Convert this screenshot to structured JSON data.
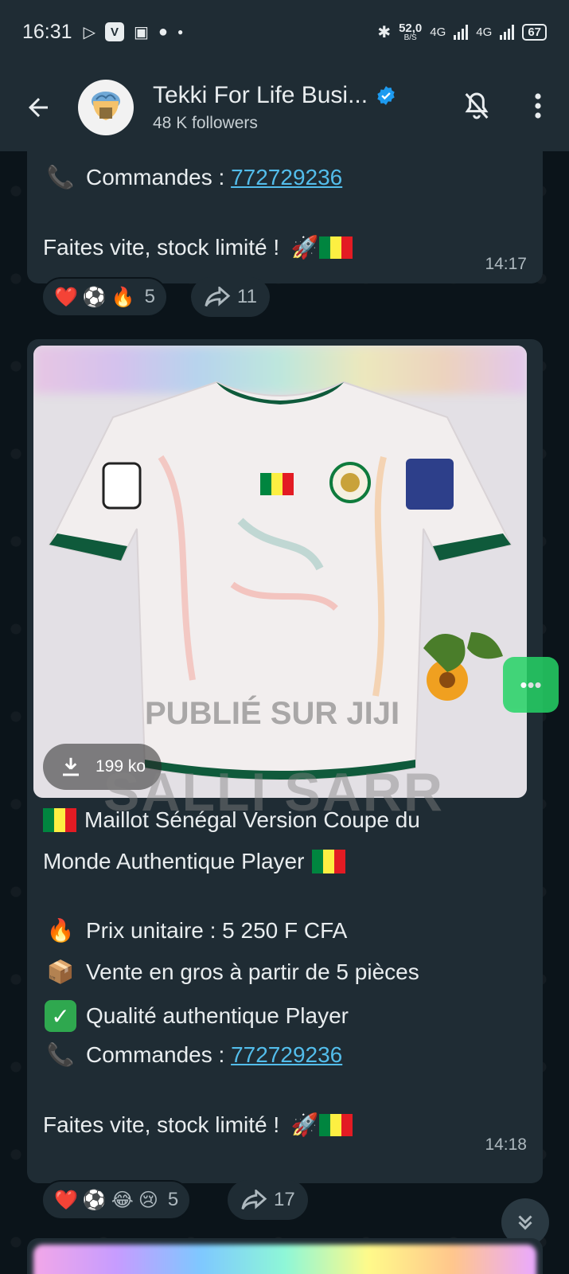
{
  "status_bar": {
    "time": "16:31",
    "network_speed": "52,0",
    "network_unit": "B/S",
    "network_type_1": "4G",
    "network_type_2": "4G",
    "battery": "67"
  },
  "header": {
    "channel_name": "Tekki For Life Busi...",
    "followers": "48 K followers"
  },
  "messages": [
    {
      "phone_label": "Commandes : ",
      "phone_number": "772729236",
      "closing": "Faites vite, stock limité !",
      "time": "14:17",
      "reactions": {
        "count": "5",
        "emojis": [
          "❤️",
          "⚽",
          "🔥"
        ]
      },
      "forwards": "11"
    },
    {
      "image": {
        "file_size": "199 ko",
        "watermark_1": "PUBLIÉ SUR JIJI",
        "watermark_2": "SALLI SARR"
      },
      "title_line_1": "Maillot Sénégal Version Coupe du",
      "title_line_2": "Monde Authentique Player",
      "price_line": "Prix unitaire : 5 250 F CFA",
      "wholesale_line": "Vente en gros à partir de 5 pièces",
      "quality_line": "Qualité authentique Player",
      "phone_label": "Commandes : ",
      "phone_number": "772729236",
      "closing": "Faites vite, stock limité !",
      "time": "14:18",
      "reactions": {
        "count": "5",
        "emojis": [
          "❤️",
          "⚽",
          "😂",
          "😢"
        ]
      },
      "forwards": "17"
    }
  ],
  "colors": {
    "background": "#0b141a",
    "bubble": "#1f2c34",
    "link": "#53bdeb",
    "verified": "#1d9bf0"
  }
}
